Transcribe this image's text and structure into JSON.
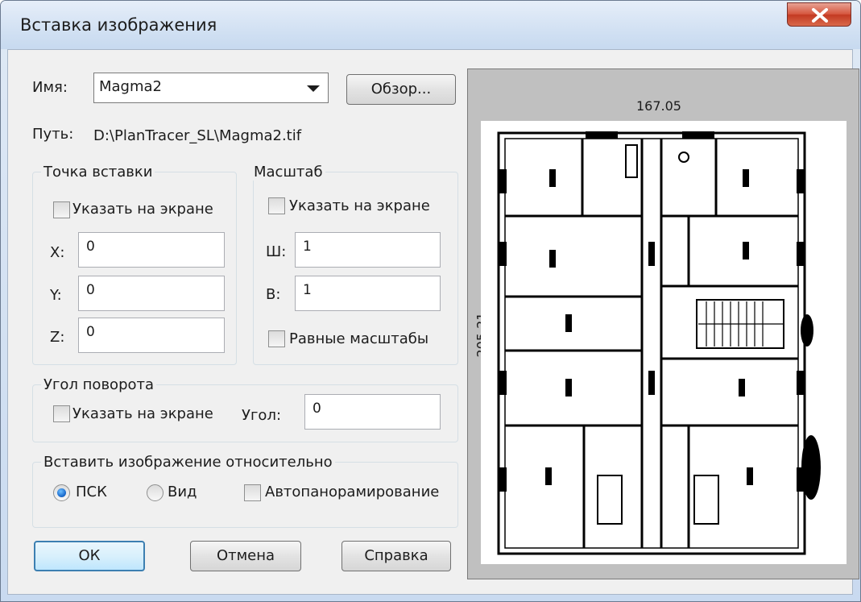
{
  "window": {
    "title": "Вставка изображения",
    "close_glyph": "X"
  },
  "name_row": {
    "label": "Имя:",
    "selected_value": "Magma2",
    "browse_button": "Обзор..."
  },
  "path_row": {
    "label": "Путь:",
    "value": "D:\\PlanTracer_SL\\Magma2.tif"
  },
  "insertion_point": {
    "group_title": "Точка вставки",
    "specify_on_screen": {
      "label": "Указать на экране",
      "checked": false
    },
    "x": {
      "label": "X:",
      "value": "0"
    },
    "y": {
      "label": "Y:",
      "value": "0"
    },
    "z": {
      "label": "Z:",
      "value": "0"
    }
  },
  "scale": {
    "group_title": "Масштаб",
    "specify_on_screen": {
      "label": "Указать на экране",
      "checked": false
    },
    "width": {
      "label": "Ш:",
      "value": "1"
    },
    "height": {
      "label": "В:",
      "value": "1"
    },
    "uniform": {
      "label": "Равные масштабы",
      "checked": false
    }
  },
  "rotation": {
    "group_title": "Угол поворота",
    "specify_on_screen": {
      "label": "Указать на экране",
      "checked": false
    },
    "angle": {
      "label": "Угол:",
      "value": "0"
    }
  },
  "insert_relative": {
    "group_title": "Вставить изображение относительно",
    "options": [
      {
        "label": "ПСК",
        "selected": true
      },
      {
        "label": "Вид",
        "selected": false
      }
    ],
    "autopan": {
      "label": "Автопанорамирование",
      "checked": false
    }
  },
  "buttons": {
    "ok": "ОК",
    "cancel": "Отмена",
    "help": "Справка"
  },
  "preview": {
    "width_dim": "167.05",
    "height_dim": "205.21"
  },
  "colors": {
    "title_bar": "#cfdff2",
    "close_button": "#c33a22",
    "dialog_bg": "#f0f0f0",
    "preview_bg": "#c0c0c0",
    "default_button_border": "#3c7fb1",
    "radio_selected": "#1f6fd0"
  }
}
